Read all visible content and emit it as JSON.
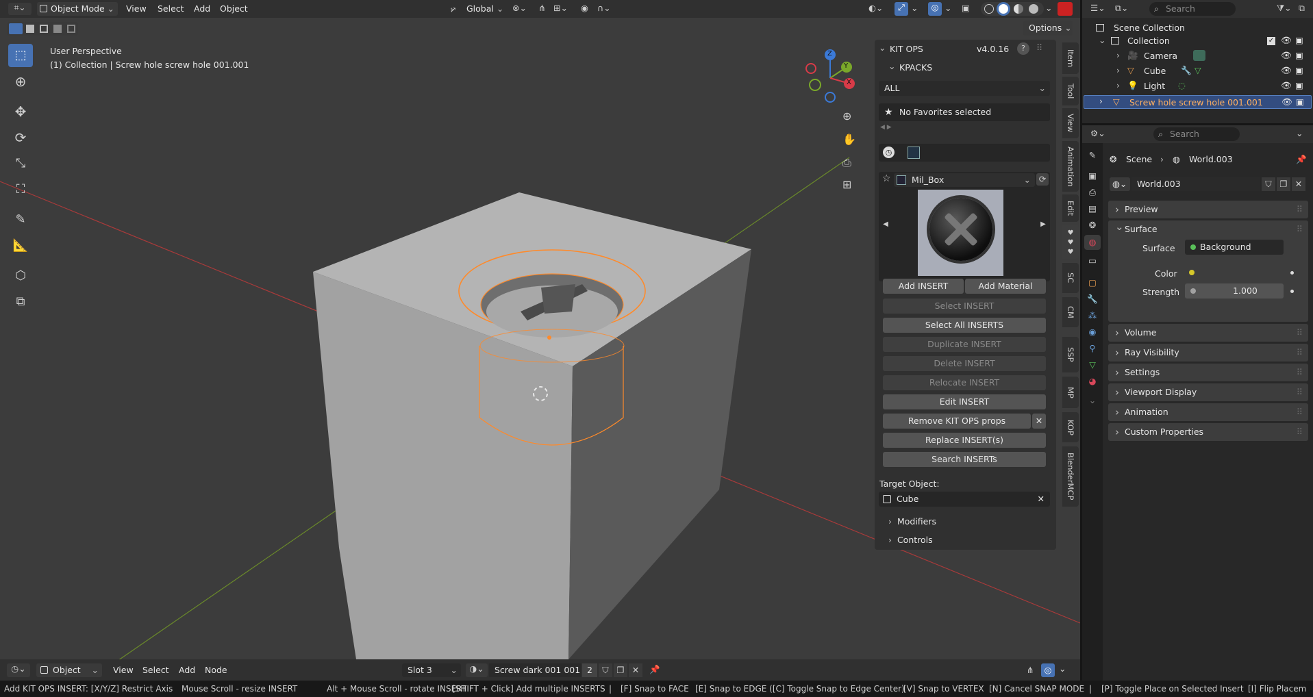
{
  "header": {
    "mode": "Object Mode",
    "menus": [
      "View",
      "Select",
      "Add",
      "Object"
    ],
    "transform": "Global",
    "options": "Options"
  },
  "viewport": {
    "perspective": "User Perspective",
    "collection_info": "(1) Collection | Screw hole screw hole 001.001",
    "axis_x": "X",
    "axis_y": "Y",
    "axis_z": "Z"
  },
  "kitops": {
    "title": "KIT OPS",
    "version": "v4.0.16",
    "kpacks": "KPACKS",
    "filter": "ALL",
    "favorites": "No Favorites selected",
    "insert_name": "Mil_Box",
    "buttons": {
      "add_insert": "Add INSERT",
      "add_material": "Add Material",
      "select_insert": "Select INSERT",
      "select_all": "Select All INSERTS",
      "duplicate": "Duplicate INSERT",
      "delete": "Delete INSERT",
      "relocate": "Relocate INSERT",
      "edit": "Edit INSERT",
      "remove_props": "Remove KIT OPS props",
      "replace": "Replace INSERT(s)",
      "search": "Search INSERTs"
    },
    "target_label": "Target Object:",
    "target_value": "Cube",
    "modifiers": "Modifiers",
    "controls": "Controls"
  },
  "sidetabs": [
    "Item",
    "Tool",
    "View",
    "Animation",
    "Edit",
    "SC",
    "CM",
    "SSP",
    "MP",
    "KOP",
    "BlenderMCP"
  ],
  "outliner": {
    "search_placeholder": "Search",
    "scene_collection": "Scene Collection",
    "collection": "Collection",
    "items": [
      "Camera",
      "Cube",
      "Light"
    ],
    "selected": "Screw hole screw hole 001.001"
  },
  "properties": {
    "search_placeholder": "Search",
    "breadcrumb_scene": "Scene",
    "breadcrumb_world": "World.003",
    "world_name": "World.003",
    "preview": "Preview",
    "surface_section": "Surface",
    "surface_label": "Surface",
    "surface_value": "Background",
    "color_label": "Color",
    "strength_label": "Strength",
    "strength_value": "1.000",
    "sections": [
      "Volume",
      "Ray Visibility",
      "Settings",
      "Viewport Display",
      "Animation",
      "Custom Properties"
    ]
  },
  "bottom_header": {
    "editor": "Object",
    "menus": [
      "View",
      "Select",
      "Add",
      "Node"
    ],
    "slot": "Slot 3",
    "material": "Screw dark 001 001",
    "users": "2"
  },
  "statusbar": [
    "Add KIT OPS INSERT: [X/Y/Z] Restrict Axis",
    "Mouse Scroll - resize INSERT",
    "Alt + Mouse Scroll - rotate INSERT",
    "[SHIFT + Click] Add multiple INSERTS",
    "|",
    "[F] Snap to FACE",
    "[E] Snap to EDGE ([C] Toggle Snap to Edge Center)",
    "[V] Snap to VERTEX",
    "[N] Cancel SNAP MODE",
    "|",
    "[P] Toggle Place on Selected Insert",
    "[I] Flip Placem"
  ],
  "colors": {
    "accent_orange": "#ff8a2a",
    "selected_row": "#334d80",
    "viewport_bg": "#3d3d3d"
  }
}
